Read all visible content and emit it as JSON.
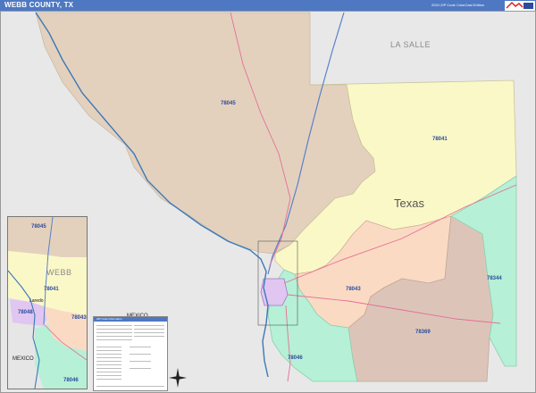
{
  "header": {
    "title": "WEBB COUNTY, TX",
    "edition": "2024 ZIP Code ColorCast Edition"
  },
  "map": {
    "county_label": "LA SALLE",
    "state_label": "Texas",
    "country_label": "MEXICO",
    "zip_labels": [
      "78045",
      "78041",
      "78043",
      "78344",
      "78369",
      "78046"
    ],
    "colors": {
      "zip_78045": "#e3d1be",
      "zip_78041": "#fbf8c8",
      "zip_78043": "#fbdac4",
      "zip_78344": "#b6f0d6",
      "zip_78369": "#dcc5b8",
      "zip_78046": "#b6f0d6",
      "laredo_core": "#e0c6f1",
      "outside": "#e8e8e8",
      "water": "#3b79b8",
      "highway": "#e56f96",
      "header": "#4e78c2"
    }
  },
  "inset": {
    "county_label": "WEBB",
    "country_label": "MEXICO",
    "city_label": "Laredo",
    "zip_labels": [
      "78045",
      "78041",
      "78048",
      "78043",
      "78046"
    ]
  },
  "legend": {
    "title": "ZIP Code Information"
  }
}
